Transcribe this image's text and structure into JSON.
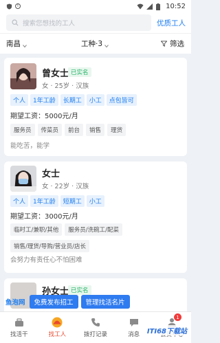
{
  "status_bar": {
    "time": "10:52"
  },
  "search": {
    "placeholder": "搜索您想找的工人",
    "premium_link": "优质工人"
  },
  "filters": {
    "city": "南昌",
    "work_type": "工种·3",
    "more": "筛选"
  },
  "workers": [
    {
      "name": "曾女士",
      "verified": "已实名",
      "meta": "女 · 25岁 · 汉族",
      "tags": [
        "个人",
        "1年工龄",
        "长期工",
        "小工",
        "点包皆可"
      ],
      "salary": "期望工资：5000元/月",
      "skills": [
        "服务员",
        "传菜员",
        "前台",
        "销售",
        "理货"
      ],
      "description": "能吃苦，能学"
    },
    {
      "name": "女士",
      "verified": "",
      "meta": "女 · 22岁 · 汉族",
      "tags": [
        "个人",
        "1年工龄",
        "短期工",
        "小工"
      ],
      "salary": "期望工资：3000元/月",
      "skills": [
        "临时工/兼职/其他",
        "服务员/洗碗工/配菜",
        "销售/理货/导购/营业员/店长"
      ],
      "description": "会努力有责任心不怕困难"
    },
    {
      "name": "孙女士",
      "verified": "已实名",
      "meta": "",
      "tags": [],
      "salary": "",
      "skills": [],
      "description": ""
    }
  ],
  "float_bar": {
    "brand": "鱼泡网",
    "post_job": "免费发布招工",
    "manage_card": "管理找活名片"
  },
  "bottom_nav": [
    {
      "label": "找活干",
      "icon": "worker-icon",
      "active": false
    },
    {
      "label": "找工人",
      "icon": "find-worker-icon",
      "active": true
    },
    {
      "label": "拨打记录",
      "icon": "call-log-icon",
      "active": false
    },
    {
      "label": "消息",
      "icon": "message-icon",
      "active": false,
      "badge": ""
    },
    {
      "label": "会员中心",
      "icon": "member-icon",
      "active": false,
      "badge": "1"
    }
  ],
  "watermark": "ITI68下载站",
  "colors": {
    "accent": "#1e7ef0",
    "active_nav": "#e84a2e",
    "verified": "#29b36a"
  }
}
